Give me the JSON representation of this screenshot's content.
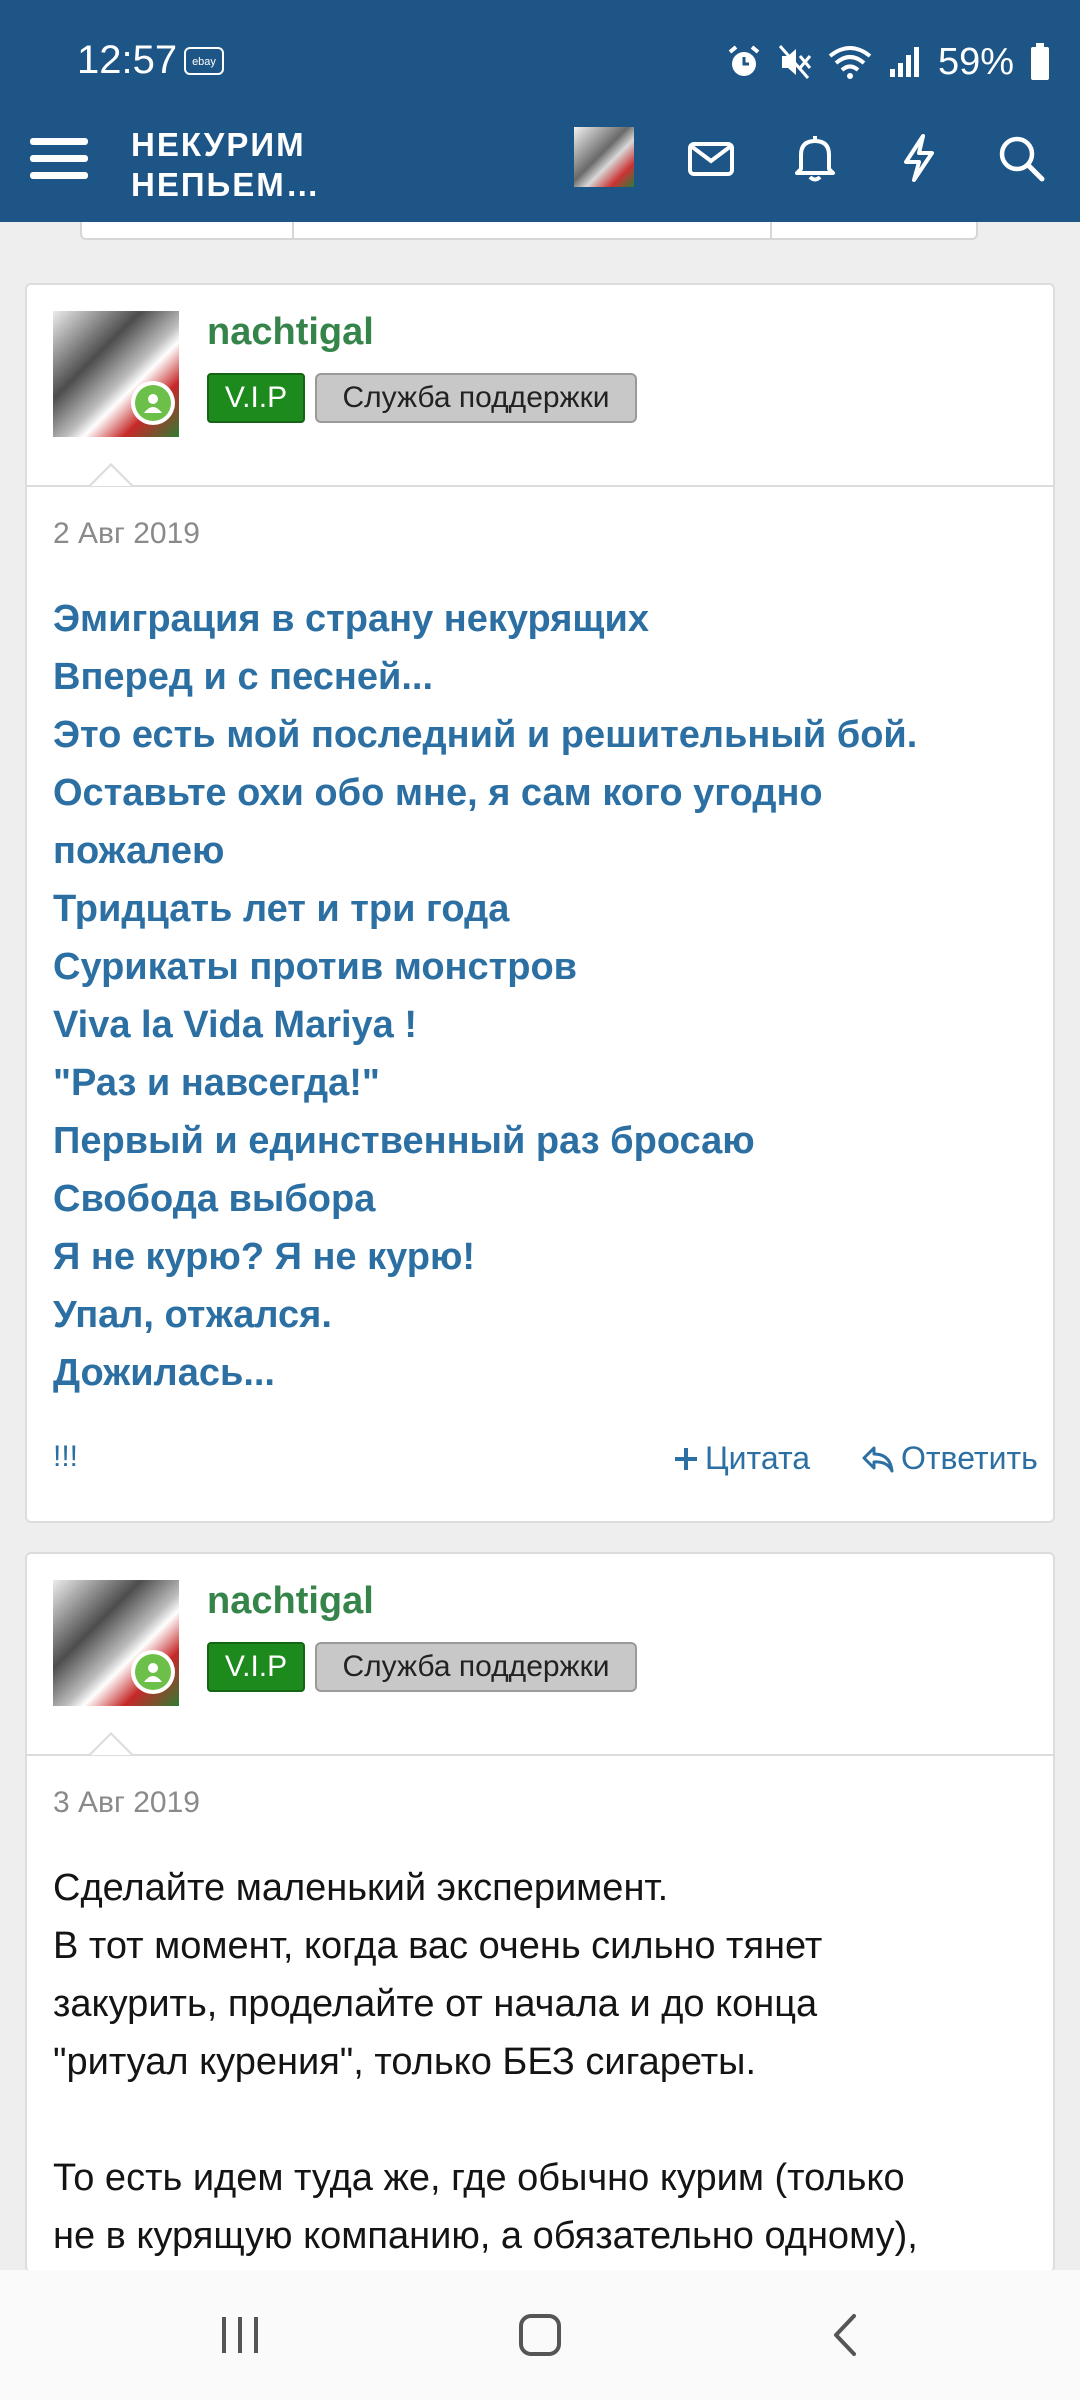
{
  "status_bar": {
    "time": "12:57",
    "ebay_label": "ebay",
    "battery": "59%"
  },
  "nav": {
    "logo_line1": "НЕКУРИМ",
    "logo_line2": "НЕПЬЕМ…",
    "icons": [
      "menu-icon",
      "avatar",
      "mail-icon",
      "bell-icon",
      "bolt-icon",
      "search-icon"
    ]
  },
  "posts": [
    {
      "username": "nachtigal",
      "badge_vip": "V.I.P",
      "badge_role": "Служба поддержки",
      "date": "2 Авг 2019",
      "lines": [
        "Эмиграция в страну некурящих",
        "Вперед и с песней...",
        "Это есть мой последний и решительный бой.",
        "Оставьте охи обо мне, я сам кого угодно",
        "пожалею",
        "Тридцать лет и три года",
        "Сурикаты против монстров",
        "Viva la Vida Mariya !",
        "\"Раз и навсегда!\"",
        "Первый и единственный раз бросаю",
        "Свобода выбора",
        "Я не курю? Я не курю!",
        "Упал, отжался.",
        "Дожилась..."
      ],
      "footer_left": "!!!",
      "quote_label": "Цитата",
      "reply_label": "Ответить"
    },
    {
      "username": "nachtigal",
      "badge_vip": "V.I.P",
      "badge_role": "Служба поддержки",
      "date": "3 Авг 2019",
      "lines": [
        "Сделайте маленький эксперимент.",
        "В тот момент, когда вас очень сильно тянет",
        "закурить, проделайте от начала и до конца",
        "\"ритуал курения\", только БЕЗ сигареты.",
        "",
        "То есть идем туда же, где обычно курим (только",
        "не в курящую компанию, а обязательно одному),"
      ]
    }
  ],
  "colors": {
    "appbar": "#1c5586",
    "link": "#2c6fa3",
    "username": "#35844a",
    "vip": "#1c8a1c",
    "online": "#6cc04a"
  }
}
